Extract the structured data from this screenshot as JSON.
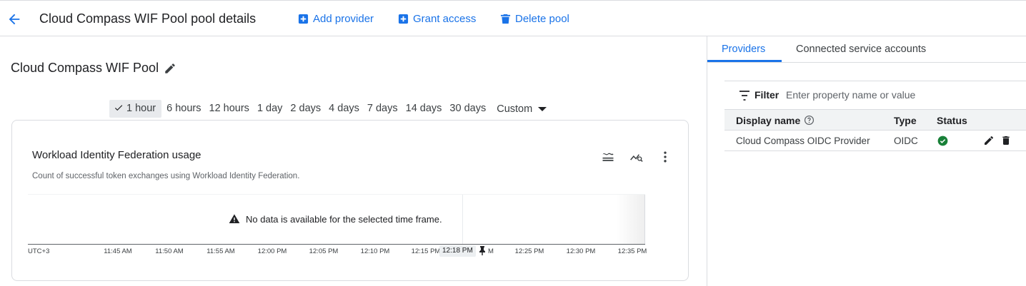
{
  "header": {
    "title": "Cloud Compass WIF Pool pool details",
    "actions": {
      "add_provider": "Add provider",
      "grant_access": "Grant access",
      "delete_pool": "Delete pool"
    }
  },
  "pool": {
    "name": "Cloud Compass WIF Pool"
  },
  "time_ranges": {
    "options": [
      "1 hour",
      "6 hours",
      "12 hours",
      "1 day",
      "2 days",
      "4 days",
      "7 days",
      "14 days",
      "30 days"
    ],
    "selected": "1 hour",
    "custom_label": "Custom"
  },
  "usage_card": {
    "title": "Workload Identity Federation usage",
    "description": "Count of successful token exchanges using Workload Identity Federation.",
    "no_data": "No data is available for the selected time frame.",
    "timezone": "UTC+3",
    "ticks": [
      "11:45 AM",
      "11:50 AM",
      "11:55 AM",
      "12:00 PM",
      "12:05 PM",
      "12:10 PM",
      "12:15 PM",
      "12:25 PM",
      "12:30 PM",
      "12:35 PM"
    ],
    "cursor_label": "12:18 PM",
    "cursor_suffix": "M"
  },
  "tabs": {
    "providers": "Providers",
    "connected": "Connected service accounts",
    "active": "Providers"
  },
  "filter": {
    "label": "Filter",
    "placeholder": "Enter property name or value"
  },
  "table": {
    "headers": {
      "display_name": "Display name",
      "type": "Type",
      "status": "Status"
    },
    "rows": [
      {
        "display_name": "Cloud Compass OIDC Provider",
        "type": "OIDC",
        "status": "ok"
      }
    ]
  },
  "colors": {
    "accent": "#1a73e8",
    "success": "#188038"
  }
}
